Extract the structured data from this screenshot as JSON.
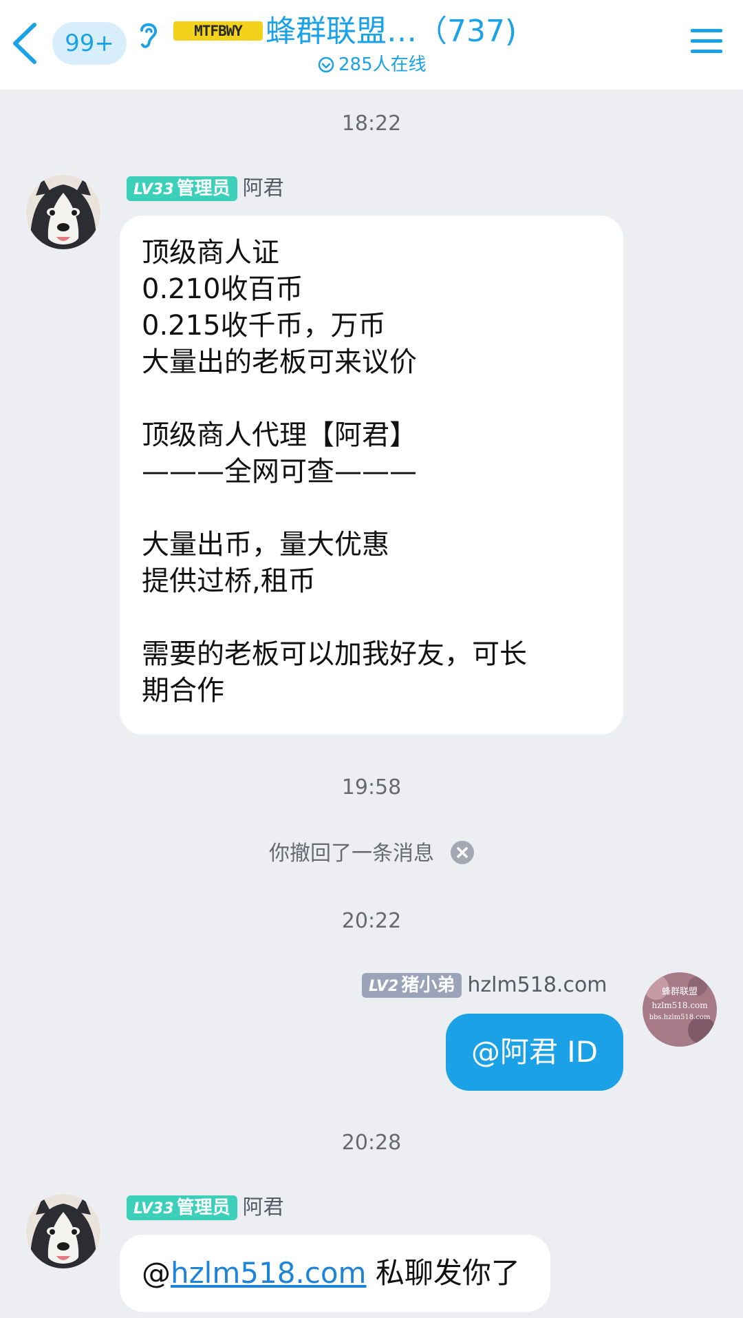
{
  "header": {
    "unread_count": "99+",
    "group_logo_text": "MTFBWY",
    "group_title": "蜂群联盟…（737)",
    "online_text": "285人在线"
  },
  "messages": [
    {
      "type": "timestamp",
      "text": "18:22"
    },
    {
      "type": "incoming",
      "level": "LV33",
      "role": "管理员",
      "sender": "阿君",
      "lines": [
        "顶级商人证",
        "0.210收百币",
        "0.215收千币，万币",
        "大量出的老板可来议价",
        "",
        "顶级商人代理【阿君】",
        "———全网可查———",
        "",
        "大量出币，量大优惠",
        "提供过桥,租币",
        "",
        "需要的老板可以加我好友，可长",
        "期合作"
      ]
    },
    {
      "type": "timestamp",
      "text": "19:58"
    },
    {
      "type": "system",
      "text": "你撤回了一条消息"
    },
    {
      "type": "timestamp",
      "text": "20:22"
    },
    {
      "type": "outgoing",
      "level": "LV2",
      "role": "猪小弟",
      "sender": "hzlm518.com",
      "text": "@阿君 ID",
      "avatar_text": [
        "蜂群联盟",
        "hzlm518.com",
        "bbs.hzlm518.com"
      ]
    },
    {
      "type": "timestamp",
      "text": "20:28"
    },
    {
      "type": "incoming",
      "level": "LV33",
      "role": "管理员",
      "sender": "阿君",
      "at_symbol": "@",
      "mention": "hzlm518.com",
      "text_after": " 私聊发你了"
    }
  ],
  "colors": {
    "accent": "#1aa1e6",
    "admin_badge": "#3ccfb9",
    "member_badge": "#9aa3b7",
    "chat_background": "#edeef2"
  },
  "icons": [
    "back-arrow-icon",
    "ear-icon",
    "online-status-icon",
    "menu-icon",
    "close-circle-icon"
  ]
}
